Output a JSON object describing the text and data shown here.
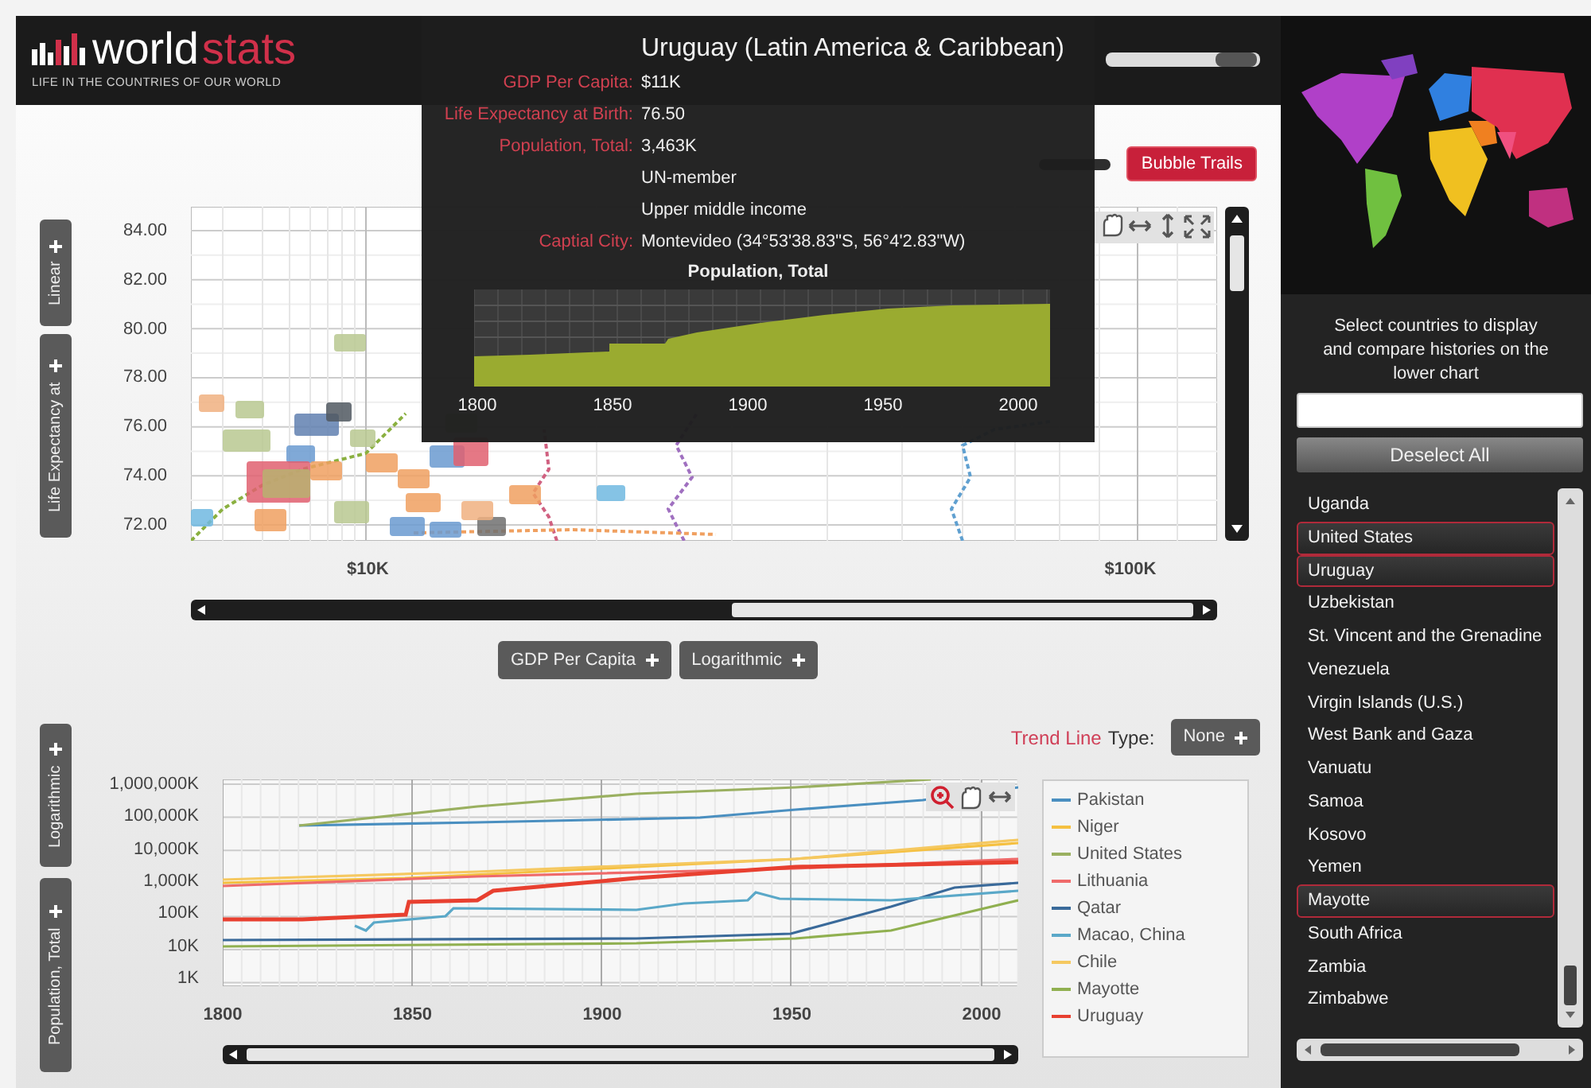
{
  "header": {
    "logo_part_1": "world",
    "logo_part_2": "stats",
    "tagline": "LIFE IN THE COUNTRIES OF OUR WORLD",
    "timeline_slider": {
      "level": 0.97
    }
  },
  "tooltip": {
    "title": "Uruguay (Latin America & Caribbean)",
    "rows": [
      {
        "label": "GDP Per Capita:",
        "value": "$11K"
      },
      {
        "label": "Life Expectancy at Birth:",
        "value": "76.50"
      },
      {
        "label": "Population, Total:",
        "value": "3,463K"
      },
      {
        "value": "UN-member"
      },
      {
        "value": "Upper middle income"
      },
      {
        "label": "Captial City:",
        "value": "Montevideo (34°53'38.83\"S, 56°4'2.83\"W)"
      }
    ],
    "chart_title": "Population, Total",
    "chart_x_labels": [
      "1800",
      "1850",
      "1900",
      "1950",
      "2000"
    ]
  },
  "bubble_chart": {
    "trails_button": "Bubble Trails",
    "y_axis_buttons": [
      "Linear",
      "Life Expectancy at"
    ],
    "y_ticks": [
      "84.00",
      "82.00",
      "80.00",
      "78.00",
      "76.00",
      "74.00",
      "72.00"
    ],
    "x_ticks": [
      "$10K",
      "$100K"
    ],
    "x_axis_buttons": [
      "GDP Per Capita",
      "Logarithmic"
    ]
  },
  "history_chart": {
    "y_axis_buttons": [
      "Logarithmic",
      "Population, Total"
    ],
    "trend_label_highlight": "Trend Line",
    "trend_label": "Type:",
    "trend_button": "None",
    "y_ticks": [
      "1,000,000K",
      "100,000K",
      "10,000K",
      "1,000K",
      "100K",
      "10K",
      "1K"
    ],
    "x_ticks": [
      "1800",
      "1850",
      "1900",
      "1950",
      "2000"
    ],
    "legend": [
      {
        "name": "Pakistan",
        "color": "#4a8fc0"
      },
      {
        "name": "Niger",
        "color": "#f5c040"
      },
      {
        "name": "United States",
        "color": "#9ab060"
      },
      {
        "name": "Lithuania",
        "color": "#ef6a6a"
      },
      {
        "name": "Qatar",
        "color": "#3a6a9a"
      },
      {
        "name": "Macao, China",
        "color": "#5aa8c8"
      },
      {
        "name": "Chile",
        "color": "#f5c860"
      },
      {
        "name": "Mayotte",
        "color": "#90b050"
      },
      {
        "name": "Uruguay",
        "color": "#e84030"
      }
    ]
  },
  "sidebar": {
    "instructions": "Select countries to display and compare histories on the lower chart",
    "deselect_button": "Deselect All",
    "countries": [
      {
        "name": "Uganda",
        "selected": false
      },
      {
        "name": "United States",
        "selected": true
      },
      {
        "name": "Uruguay",
        "selected": true
      },
      {
        "name": "Uzbekistan",
        "selected": false
      },
      {
        "name": "St. Vincent and the Grenadine",
        "selected": false
      },
      {
        "name": "Venezuela",
        "selected": false
      },
      {
        "name": "Virgin Islands (U.S.)",
        "selected": false
      },
      {
        "name": "West Bank and Gaza",
        "selected": false
      },
      {
        "name": "Vanuatu",
        "selected": false
      },
      {
        "name": "Samoa",
        "selected": false
      },
      {
        "name": "Kosovo",
        "selected": false
      },
      {
        "name": "Yemen",
        "selected": false
      },
      {
        "name": "Mayotte",
        "selected": true
      },
      {
        "name": "South Africa",
        "selected": false
      },
      {
        "name": "Zambia",
        "selected": false
      },
      {
        "name": "Zimbabwe",
        "selected": false
      }
    ]
  }
}
